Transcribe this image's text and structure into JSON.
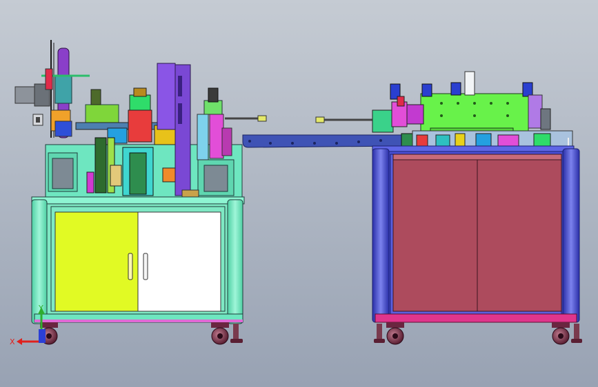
{
  "scene": {
    "type": "cad-assembly-view",
    "view": "front",
    "background_top": "#c5cbd3",
    "background_bottom": "#98a2b3"
  },
  "triad": {
    "x_label": "X",
    "y_label": "Y",
    "x_color": "#e0201c",
    "y_color": "#2fae2f",
    "z_color": "#2b3fd6"
  },
  "machines": [
    {
      "id": "left-machine",
      "frame_color": "#74f0c8",
      "door_left_color": "#e1fa24",
      "door_right_color": "#ffffff"
    },
    {
      "id": "right-machine",
      "frame_color": "#4a4fd6",
      "door_color": "#ad4b5d",
      "top_module_color": "#68f24a"
    }
  ],
  "conveyor": {
    "color": "#3f53b5"
  }
}
